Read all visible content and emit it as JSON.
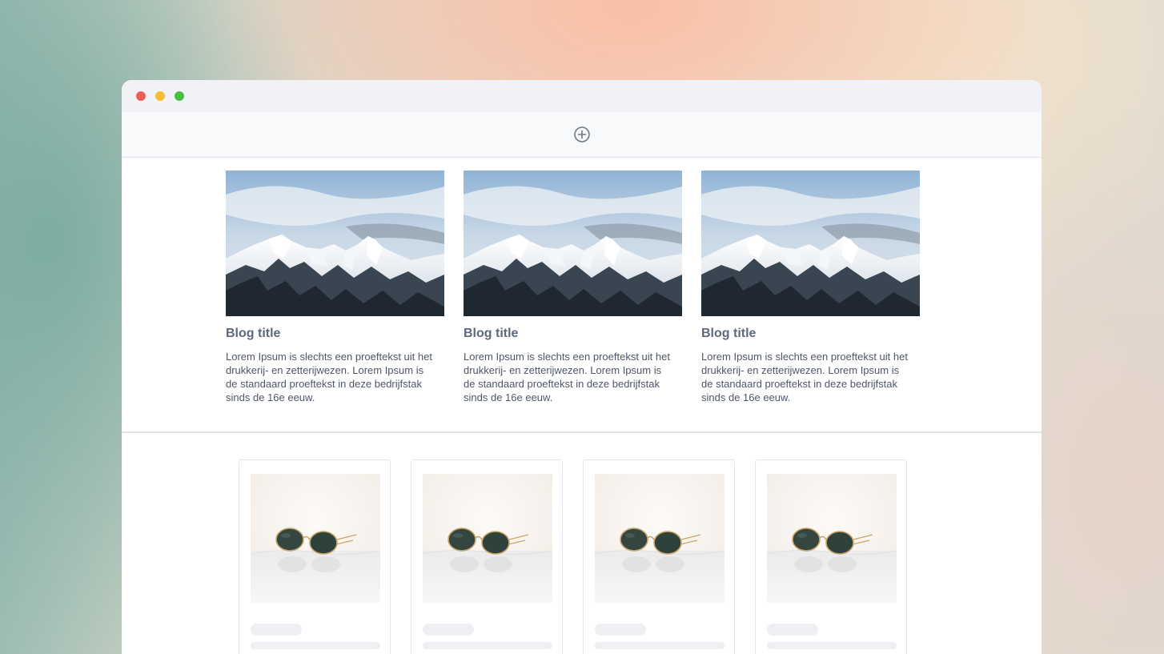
{
  "window": {
    "controls": [
      "close",
      "minimize",
      "maximize"
    ]
  },
  "toolbar": {
    "add_icon": "plus-circle-icon"
  },
  "blog": {
    "posts": [
      {
        "title": "Blog title",
        "text": "Lorem Ipsum is slechts een proeftekst uit het drukkerij- en zetterijwezen. Lorem Ipsum is de standaard proeftekst in deze bedrijfstak sinds de 16e eeuw.",
        "image": "snowy-mountains"
      },
      {
        "title": "Blog title",
        "text": "Lorem Ipsum is slechts een proeftekst uit het drukkerij- en zetterijwezen. Lorem Ipsum is de standaard proeftekst in deze bedrijfstak sinds de 16e eeuw.",
        "image": "snowy-mountains"
      },
      {
        "title": "Blog title",
        "text": "Lorem Ipsum is slechts een proeftekst uit het drukkerij- en zetterijwezen. Lorem Ipsum is de standaard proeftekst in deze bedrijfstak sinds de 16e eeuw.",
        "image": "snowy-mountains"
      }
    ]
  },
  "products": {
    "items": [
      {
        "image": "sunglasses"
      },
      {
        "image": "sunglasses"
      },
      {
        "image": "sunglasses"
      },
      {
        "image": "sunglasses"
      }
    ]
  },
  "colors": {
    "close": "#ec5f56",
    "minimize": "#f5bd33",
    "maximize": "#46c043",
    "title_text": "#5d6878",
    "body_text": "#4e5766",
    "skeleton": "#eeeef3"
  }
}
